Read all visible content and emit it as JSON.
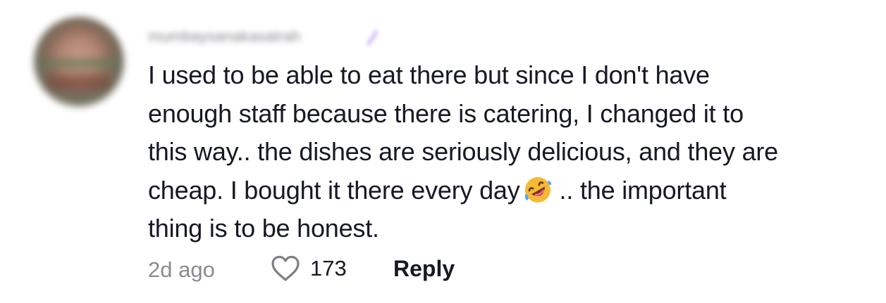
{
  "comment": {
    "username": "mumbaysanakasatrah",
    "text_lines": [
      "I used to be able to eat there but since I don't have",
      "enough staff because there is catering, I changed it to",
      "this way.. the dishes are seriously delicious, and they are",
      "cheap. I bought it there every day",
      ".. the important",
      "thing is to be honest."
    ],
    "emoji": "rolling-on-the-floor-laughing-icon",
    "time": "2d ago",
    "likes": "173",
    "reply_label": "Reply"
  },
  "colors": {
    "text": "#161823",
    "muted": "#8a8b91",
    "verified": "#c9b8f5",
    "emoji_face": "#f6b936",
    "emoji_tear": "#4aa3ff"
  }
}
